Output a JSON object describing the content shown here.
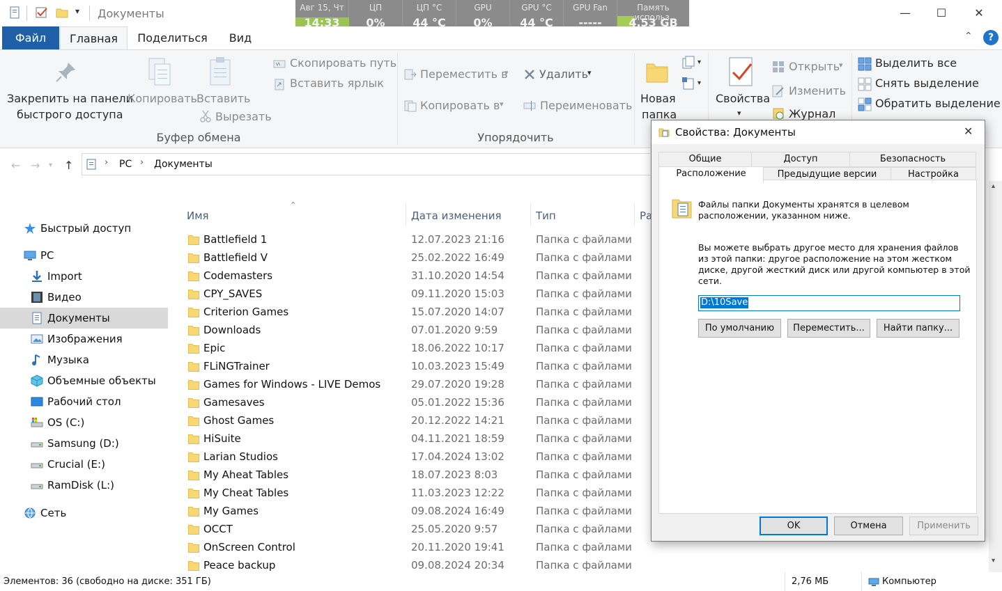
{
  "window": {
    "title": "Документы",
    "controls": {
      "minimize": "—",
      "maximize": "☐",
      "close": "✕"
    }
  },
  "hwmonitor": [
    {
      "label": "Авг 15, Чт",
      "value": "14:33"
    },
    {
      "label": "ЦП",
      "value": "0%"
    },
    {
      "label": "ЦП °C",
      "value": "44 °C"
    },
    {
      "label": "GPU",
      "value": "0%"
    },
    {
      "label": "GPU °C",
      "value": "44 °C"
    },
    {
      "label": "GPU Fan",
      "value": "-----"
    },
    {
      "label": "Память использ.",
      "value": "4.53 GB"
    }
  ],
  "ribbon_tabs": [
    "Файл",
    "Главная",
    "Поделиться",
    "Вид"
  ],
  "ribbon": {
    "pin_line1": "Закрепить на панели",
    "pin_line2": "быстрого доступа",
    "copy": "Копировать",
    "paste": "Вставить",
    "copy_path": "Скопировать путь",
    "paste_shortcut": "Вставить ярлык",
    "cut": "Вырезать",
    "group_clipboard": "Буфер обмена",
    "move_to": "Переместить в",
    "copy_to": "Копировать в",
    "delete": "Удалить",
    "rename": "Переименовать",
    "group_organize": "Упорядочить",
    "new_folder_line1": "Новая",
    "new_folder_line2": "папка",
    "properties": "Свойства",
    "open": "Открыть",
    "edit": "Изменить",
    "history": "Журнал",
    "select_all": "Выделить все",
    "select_none": "Снять выделение",
    "invert_selection": "Обратить выделение"
  },
  "address": {
    "crumbs": [
      "PC",
      "Документы"
    ]
  },
  "nav": [
    {
      "label": "Быстрый доступ",
      "icon": "star-icon",
      "indent": 0
    },
    {
      "label": "PC",
      "icon": "pc-icon",
      "indent": 0
    },
    {
      "label": "Import",
      "icon": "download-icon",
      "indent": 1
    },
    {
      "label": "Видео",
      "icon": "video-icon",
      "indent": 1
    },
    {
      "label": "Документы",
      "icon": "documents-icon",
      "indent": 1,
      "selected": true
    },
    {
      "label": "Изображения",
      "icon": "pictures-icon",
      "indent": 1
    },
    {
      "label": "Музыка",
      "icon": "music-icon",
      "indent": 1
    },
    {
      "label": "Объемные объекты",
      "icon": "3d-objects-icon",
      "indent": 1
    },
    {
      "label": "Рабочий стол",
      "icon": "desktop-icon",
      "indent": 1
    },
    {
      "label": "OS (C:)",
      "icon": "drive-c-icon",
      "indent": 1
    },
    {
      "label": "Samsung (D:)",
      "icon": "drive-icon",
      "indent": 1
    },
    {
      "label": "Crucial (E:)",
      "icon": "drive-icon",
      "indent": 1
    },
    {
      "label": "RamDisk (L:)",
      "icon": "drive-icon",
      "indent": 1
    },
    {
      "label": "Сеть",
      "icon": "network-icon",
      "indent": 0
    }
  ],
  "columns": {
    "name": "Имя",
    "date": "Дата изменения",
    "type": "Тип",
    "size": "Ра"
  },
  "files": [
    {
      "name": "Battlefield 1",
      "date": "12.07.2023 21:16",
      "type": "Папка с файлами"
    },
    {
      "name": "Battlefield V",
      "date": "25.02.2022 16:49",
      "type": "Папка с файлами"
    },
    {
      "name": "Codemasters",
      "date": "31.10.2020 14:54",
      "type": "Папка с файлами"
    },
    {
      "name": "CPY_SAVES",
      "date": "09.11.2020 15:03",
      "type": "Папка с файлами"
    },
    {
      "name": "Criterion Games",
      "date": "15.07.2020 14:07",
      "type": "Папка с файлами"
    },
    {
      "name": "Downloads",
      "date": "07.01.2020 9:59",
      "type": "Папка с файлами"
    },
    {
      "name": "Epic",
      "date": "18.06.2022 10:17",
      "type": "Папка с файлами"
    },
    {
      "name": "FLiNGTrainer",
      "date": "10.03.2023 15:49",
      "type": "Папка с файлами"
    },
    {
      "name": "Games for Windows - LIVE Demos",
      "date": "29.07.2020 19:28",
      "type": "Папка с файлами"
    },
    {
      "name": "Gamesaves",
      "date": "05.01.2022 15:36",
      "type": "Папка с файлами"
    },
    {
      "name": "Ghost Games",
      "date": "20.12.2022 14:21",
      "type": "Папка с файлами"
    },
    {
      "name": "HiSuite",
      "date": "04.11.2021 18:59",
      "type": "Папка с файлами"
    },
    {
      "name": "Larian Studios",
      "date": "17.04.2024 13:02",
      "type": "Папка с файлами"
    },
    {
      "name": "My Aheat Tables",
      "date": "18.07.2023 8:03",
      "type": "Папка с файлами"
    },
    {
      "name": "My Cheat Tables",
      "date": "11.03.2023 12:22",
      "type": "Папка с файлами"
    },
    {
      "name": "My Games",
      "date": "09.08.2024 16:49",
      "type": "Папка с файлами"
    },
    {
      "name": "OCCT",
      "date": "25.05.2020 9:57",
      "type": "Папка с файлами"
    },
    {
      "name": "OnScreen Control",
      "date": "20.11.2020 19:41",
      "type": "Папка с файлами"
    },
    {
      "name": "Peace backup",
      "date": "09.08.2024 20:34",
      "type": "Папка с файлами"
    }
  ],
  "status": {
    "items": "Элементов: 36 (свободно на диске: 351 ГБ)",
    "size": "2,76 МБ",
    "location": "Компьютер"
  },
  "dialog": {
    "title": "Свойства: Документы",
    "tabs_row1": [
      "Общие",
      "Доступ",
      "Безопасность"
    ],
    "tabs_row2": [
      "Расположение",
      "Предыдущие версии",
      "Настройка"
    ],
    "info": [
      "Файлы папки Документы хранятся в целевом",
      "расположении, указанном ниже."
    ],
    "hint": [
      "Вы можете выбрать другое место для хранения файлов",
      "из этой папки: другое расположение на этом жестком",
      "диске, другой жесткий диск или другой компьютер в этой",
      "сети."
    ],
    "path": "D:\\10Save",
    "btn_default": "По умолчанию",
    "btn_move": "Переместить...",
    "btn_find": "Найти папку...",
    "ok": "OK",
    "cancel": "Отмена",
    "apply": "Применить"
  },
  "colors": {
    "accent": "#1f5fa8",
    "folder": "#f8d775",
    "selection": "#d9d9d9",
    "hw_bar": "#a6cc58"
  }
}
